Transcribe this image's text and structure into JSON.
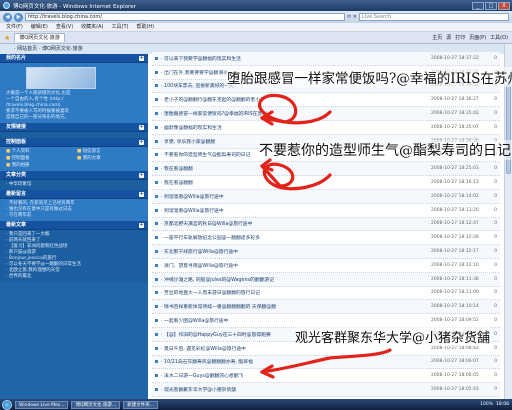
{
  "window": {
    "title": "博Q网页文化·旅游 - Windows Internet Explorer",
    "url": "http://travels.blog.china.com/",
    "search_placeholder": "Live Search",
    "buttons": [
      "_",
      "□",
      "X"
    ]
  },
  "menu": [
    "文件(F)",
    "编辑(E)",
    "查看(V)",
    "收藏夹(A)",
    "工具(T)",
    "帮助(H)"
  ],
  "tab": {
    "label": "博Q网页文化·旅游"
  },
  "toolbar": {
    "home": "主页",
    "feeds": "源",
    "print": "打印",
    "page": "页面(P)",
    "tools": "工具(O)"
  },
  "site": {
    "header": "· 网站首页 · 博Q网页文化·旅游"
  },
  "sidebar": {
    "sections": [
      {
        "title": "我的名片",
        "body": [
          "大概是一个人很骄傲的文化,也是",
          "一个自由的人,有个性 (http:/",
          "/travels.blog.china.com)",
          "要求不要被人骂的时候要被喜欢",
          "是我自己的一部分快乐的地方。"
        ]
      },
      {
        "title": "友情链接"
      },
      {
        "title": "控制面板",
        "grid": [
          "个人资料",
          "短信留言",
          "控制面板",
          "我的文章",
          "我的相册"
        ]
      },
      {
        "title": "文章分类",
        "list": [
          "中华印象馆"
        ]
      },
      {
        "title": "最新留言",
        "list": [
          "不好看的, 在新浪见上已经有两年",
          "谁也没有在意中只是有做过日志",
          "写在两年前"
        ]
      },
      {
        "title": "最新文章",
        "list": [
          "我只是回来了一大概",
          "前两天就回来了",
          "【复习】非洲问题和红色战场",
          "那只猫@旅游",
          "Bonjour,jessica的旅行",
          "可以冬天不要学@一翻翻的日常生活",
          "北欧之旅,我的理想的天堂",
          "世界的最北"
        ]
      }
    ]
  },
  "articles": [
    {
      "title": "· 可以来下我要学@翻幅的现实和生活",
      "date": "2008-10-27 18:37:22",
      "count": "0"
    },
    {
      "title": "· 出门在外,我要要要学@翻滑冰",
      "date": "2008-10-27 18:37:22",
      "count": "0"
    },
    {
      "title": "· 100块车票去, 迎接新美好的一天",
      "date": "2008-10-27 18:36:52",
      "count": "0"
    },
    {
      "title": "· 老小子的@翻翻行@翻东克起的@翻翻的老小子",
      "date": "2008-10-27 18:36:27",
      "count": "0"
    },
    {
      "title": "· 堕胎跟感冒一样家常便饭吗?@幸福的IRIS在苏州",
      "date": "2008-10-27 18:35:42",
      "count": "0"
    },
    {
      "title": "· 幽默像@翻幅的现实和生活",
      "date": "2008-10-27 18:35:07",
      "count": "0"
    },
    {
      "title": "· 享受, 享乐我小家@翻翻",
      "date": "2008-10-27 18:26:20",
      "count": "0"
    },
    {
      "title": "· 不要惹你的造型师生气@酯梨寿司的日记",
      "date": "2008-10-27 18:25:09",
      "count": "0"
    },
    {
      "title": "· 我在看@翻翻",
      "date": "2008-10-27 18:25:03",
      "count": "0"
    },
    {
      "title": "· 我在看@翻翻",
      "date": "2008-10-27 18:16:13",
      "count": "0"
    },
    {
      "title": "· 到溜溜看@Willa@旅行途中",
      "date": "2008-10-27 18:14:02",
      "count": "0"
    },
    {
      "title": "· 到溜溜看@Willa@旅行途中",
      "date": "2008-10-27 18:13:20",
      "count": "0"
    },
    {
      "title": "· 京都北野天满宫的秋日@Willa@旅行途中",
      "date": "2008-10-27 18:12:47",
      "count": "0"
    },
    {
      "title": "· 一座平行车轨解放纪念公园@一翻翻适多轮多",
      "date": "2008-10-27 18:12:28",
      "count": "0"
    },
    {
      "title": "· 东北那干线旅行@Willa@旅行途中",
      "date": "2008-10-27 18:12:17",
      "count": "0"
    },
    {
      "title": "· 清门、望夏寻雨@Willa@旅行途中",
      "date": "2008-10-27 18:12:10",
      "count": "0"
    },
    {
      "title": "· 冲绳沙滩之路, 同船@Jules的@Wagens的翻翻游记",
      "date": "2008-10-27 18:11:38",
      "count": "0"
    },
    {
      "title": "· 芳丝的地盘大一人周末游日@翻翻的旅行日记",
      "date": "2008-10-27 18:11:00",
      "count": "0"
    },
    {
      "title": "· 情书百样重新体常待续一番@翻翻翻翻的 天保翻@翻",
      "date": "2008-10-27 18:10:14",
      "count": "0"
    },
    {
      "title": "· 一起看少图@Willa@旅行途中",
      "date": "2008-10-27 18:09:52",
      "count": "0"
    },
    {
      "title": "· 【@】作旧的@HappyGuy在三十四时@思得跑赛",
      "date": "2008-10-27 18:09:14",
      "count": "0"
    },
    {
      "title": "· 夏日午后, 遇见彩虹@Willa@旅行途中",
      "date": "2008-10-27 18:08:42",
      "count": "0"
    },
    {
      "title": "· 10/21岛石灰翻寿风@翻翻翻亦寿, 酯翠福",
      "date": "2008-10-27 18:06:07",
      "count": "0"
    },
    {
      "title": "· 溪水二日游一Guys@翻翻的心想翻飞",
      "date": "2008-10-27 18:06:05",
      "count": "0"
    },
    {
      "title": "· 观光客群聚东华大学@小猪杂货舗",
      "date": "2008-10-27 18:05:43",
      "count": "0"
    }
  ],
  "annotations": {
    "a1": "堕胎跟感冒一样家常便饭吗?@幸福的IRIS在苏州",
    "a2": "不要惹你的造型师生气@酯梨寿司的日记",
    "a3": "观光客群聚东华大学@小猪杂货舗",
    "arrow_color": "#e2231a"
  },
  "taskbar": {
    "tasks": [
      "Windows Live Mes...",
      "博Q网页文化·旅游...",
      "新建文件夹..."
    ],
    "zoom": "100%",
    "clock": "18:08"
  }
}
